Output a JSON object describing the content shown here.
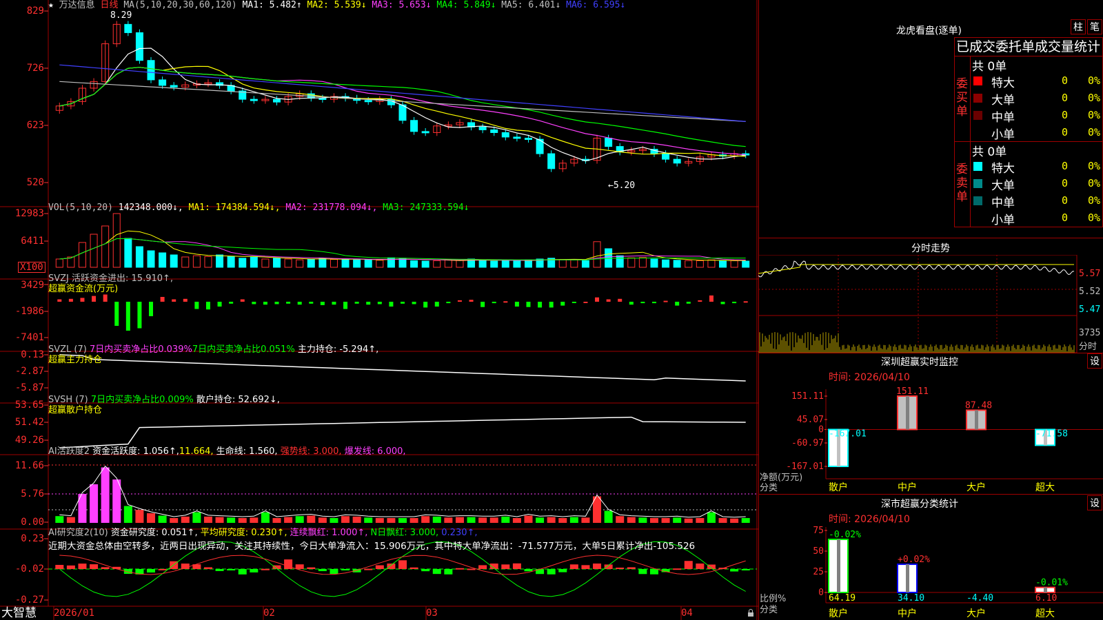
{
  "app": {
    "name": "大智慧",
    "lock_icon": "lock-icon"
  },
  "k": {
    "stock": "万达信息",
    "period": "日线",
    "star": "★",
    "ma_head": "MA(5,10,20,30,60,120)",
    "ma1": "MA1: 5.482↑",
    "ma2": "MA2: 5.539↓",
    "ma3": "MA3: 5.653↓",
    "ma4": "MA4: 5.849↓",
    "ma5": "MA5: 6.401↓",
    "ma6": "MA6: 6.595↓",
    "hi": "8.29",
    "lo": "5.20",
    "y": [
      "829",
      "726",
      "623",
      "520"
    ],
    "colors": {
      "ma1": "#ffffff",
      "ma2": "#ffff00",
      "ma3": "#ff40ff",
      "ma4": "#00ff00",
      "ma5": "#c0c0c0",
      "ma6": "#4040ff",
      "up": "#ff3030",
      "down": "#00ffff"
    }
  },
  "vol": {
    "head": "VOL(5,10,20)",
    "v": "142348.000↓,",
    "ma1": "MA1: 174384.594↓,",
    "ma2": "MA2: 231778.094↓,",
    "ma3": "MA3: 247333.594↓",
    "y": [
      "12983",
      "6411"
    ],
    "unit": "X100"
  },
  "svzj": {
    "head": "SVZJ  活跃资金进出: 15.910↑,",
    "sub": "超赢资金流(万元)",
    "y": [
      "3429",
      "-1986",
      "-7401"
    ]
  },
  "svzl": {
    "head": "SVZL (7)",
    "a": "7日内买卖净占比0.039%",
    "b": "7日内买卖净占比0.051%",
    "c": "主力持仓: -5.294↑,",
    "sub": "超赢主力持仓",
    "y": [
      "0.13",
      "-2.87",
      "-5.87"
    ]
  },
  "svsh": {
    "head": "SVSH (7)",
    "a": "7日内买卖净占比0.009%",
    "b": "散户持仓: 52.692↓,",
    "sub": "超赢散户持仓",
    "y": [
      "53.65",
      "51.42",
      "49.26"
    ]
  },
  "ai1": {
    "head": "AI活跃度2",
    "a": "资金活跃度: 1.056↑,",
    "b": "11.664,",
    "c": "生命线: 1.560,",
    "d": "强势线: 3.000,",
    "e": "爆发线: 6.000,",
    "y": [
      "11.66",
      "5.76",
      "0.00"
    ]
  },
  "ai2": {
    "head": "AI研究度2(10)",
    "a": "资金研究度: 0.051↑,",
    "b": "平均研究度: 0.230↑,",
    "c": "连续飘红: 1.000↑,",
    "d": "N日飘红: 3.000,",
    "e": "0.230↑,",
    "note": "近期大资金总体由空转多，近两日出现异动，关注其持续性，今日大单净流入：15.906万元，其中特大单净流出：-71.577万元，大单5日累计净出-105.526",
    "y": [
      "0.23",
      "-0.02",
      "-0.27"
    ]
  },
  "xaxis": [
    "2026/01",
    "02",
    "03",
    "04"
  ],
  "lhb": {
    "title": "龙虎看盘(逐单)",
    "tab1": "柱",
    "tab2": "笔",
    "header": "已成交委托单成交量统计",
    "buy": {
      "side": "委买单",
      "total": "共 0单",
      "rows": [
        {
          "label": "特大",
          "n": "0",
          "p": "0%",
          "color": "#ff0000"
        },
        {
          "label": "大单",
          "n": "0",
          "p": "0%",
          "color": "#8b0000"
        },
        {
          "label": "中单",
          "n": "0",
          "p": "0%",
          "color": "#6a0000"
        },
        {
          "label": "小单",
          "n": "0",
          "p": "0%",
          "color": "#000000"
        }
      ]
    },
    "sell": {
      "side": "委卖单",
      "total": "共 0单",
      "rows": [
        {
          "label": "特大",
          "n": "0",
          "p": "0%",
          "color": "#00ffff"
        },
        {
          "label": "大单",
          "n": "0",
          "p": "0%",
          "color": "#008b8b"
        },
        {
          "label": "中单",
          "n": "0",
          "p": "0%",
          "color": "#006a6a"
        },
        {
          "label": "小单",
          "n": "0",
          "p": "0%",
          "color": "#000000"
        }
      ]
    }
  },
  "fenshi": {
    "title": "分时走势",
    "y": [
      "5.57",
      "5.52",
      "5.47"
    ],
    "vol": "3735",
    "unit": "分时"
  },
  "szjk": {
    "title": "深圳超赢实时监控",
    "settings": "设",
    "time": "时间: 2026/04/10",
    "y": [
      "151.11",
      "45.07",
      "0",
      "-60.97",
      "-167.01"
    ],
    "ylabel1": "净额(万元)",
    "ylabel2": "分类",
    "chart_data": {
      "type": "bar",
      "categories": [
        "散户",
        "中户",
        "大户",
        "超大"
      ],
      "values": [
        -167.01,
        151.11,
        87.48,
        -71.58
      ],
      "labels": [
        "-167.01",
        "151.11",
        "87.48",
        "-71.58"
      ],
      "ylim": [
        -167.01,
        151.11
      ]
    }
  },
  "szfl": {
    "title": "深市超赢分类统计",
    "settings": "设",
    "time": "时间: 2026/04/10",
    "y": [
      "75",
      "50",
      "25",
      "0"
    ],
    "ylabel1": "比例%",
    "ylabel2": "分类",
    "chart_data": {
      "type": "bar",
      "categories": [
        "散户",
        "中户",
        "大户",
        "超大"
      ],
      "values": [
        64.19,
        34.1,
        -4.4,
        6.1
      ],
      "changes": [
        "-0.02%",
        "+0.02%",
        "",
        "-0.01%"
      ],
      "labels": [
        "64.19",
        "34.10",
        "-4.40",
        "6.10"
      ],
      "ylim": [
        0,
        75
      ]
    }
  }
}
